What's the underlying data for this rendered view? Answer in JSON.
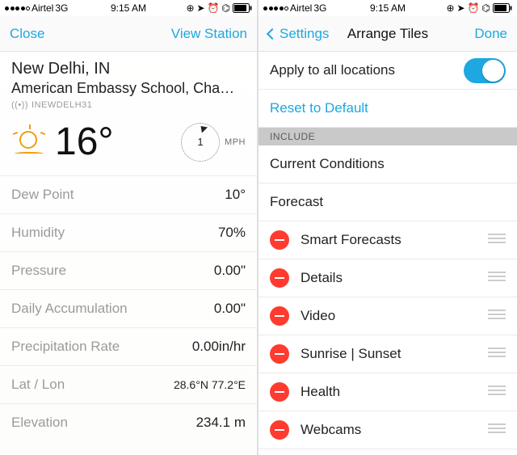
{
  "status_bar": {
    "carrier": "Airtel",
    "net": "3G",
    "time": "9:15 AM"
  },
  "left": {
    "nav_close": "Close",
    "nav_view_station": "View Station",
    "location_title": "New Delhi, IN",
    "location_subtitle": "American Embassy School, Cha…",
    "station_id": "INEWDELH31",
    "temperature": "16°",
    "wind_value": "1",
    "wind_unit": "MPH",
    "metrics": [
      {
        "label": "Dew Point",
        "value": "10°"
      },
      {
        "label": "Humidity",
        "value": "70%"
      },
      {
        "label": "Pressure",
        "value": "0.00\""
      },
      {
        "label": "Daily Accumulation",
        "value": "0.00\""
      },
      {
        "label": "Precipitation Rate",
        "value": "0.00in/hr"
      },
      {
        "label": "Lat / Lon",
        "value": "28.6°N 77.2°E"
      },
      {
        "label": "Elevation",
        "value": "234.1 m"
      }
    ]
  },
  "right": {
    "nav_back": "Settings",
    "nav_title": "Arrange Tiles",
    "nav_done": "Done",
    "apply_label": "Apply to all locations",
    "reset_label": "Reset to Default",
    "section_header": "INCLUDE",
    "fixed_items": [
      "Current Conditions",
      "Forecast"
    ],
    "editable_items": [
      "Smart Forecasts",
      "Details",
      "Video",
      "Sunrise | Sunset",
      "Health",
      "Webcams"
    ]
  }
}
